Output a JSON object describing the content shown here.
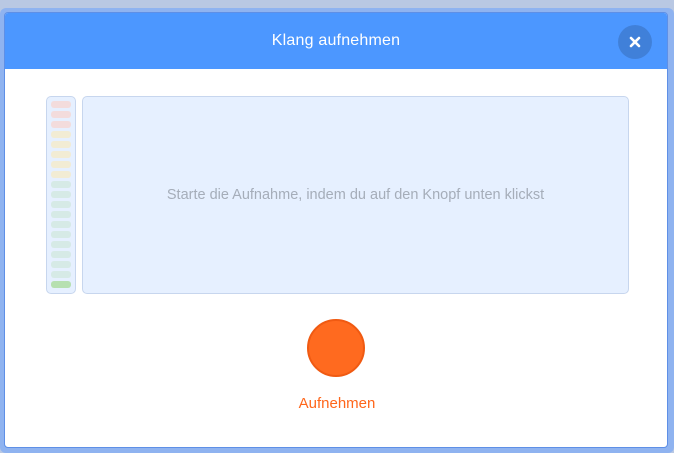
{
  "dialog": {
    "title": "Klang aufnehmen",
    "close_icon": "close-icon"
  },
  "meter": {
    "level": 0,
    "segment_colors": [
      "#f3dcdc",
      "#f3dcdc",
      "#f3dcdc",
      "#f2ecd4",
      "#f2ecd4",
      "#f2ecd4",
      "#f2ecd4",
      "#f2ecd4",
      "#d6eae6",
      "#d6eae6",
      "#d6eae6",
      "#d6eae6",
      "#d6eae6",
      "#d6eae6",
      "#d6eae6",
      "#d6eae6",
      "#d6eae6",
      "#d6eae6",
      "#b6e0b0"
    ]
  },
  "waveform": {
    "instruction": "Starte die Aufnahme, indem du auf den Knopf unten klickst"
  },
  "record": {
    "label": "Aufnehmen",
    "color": "#ff6a1f"
  }
}
